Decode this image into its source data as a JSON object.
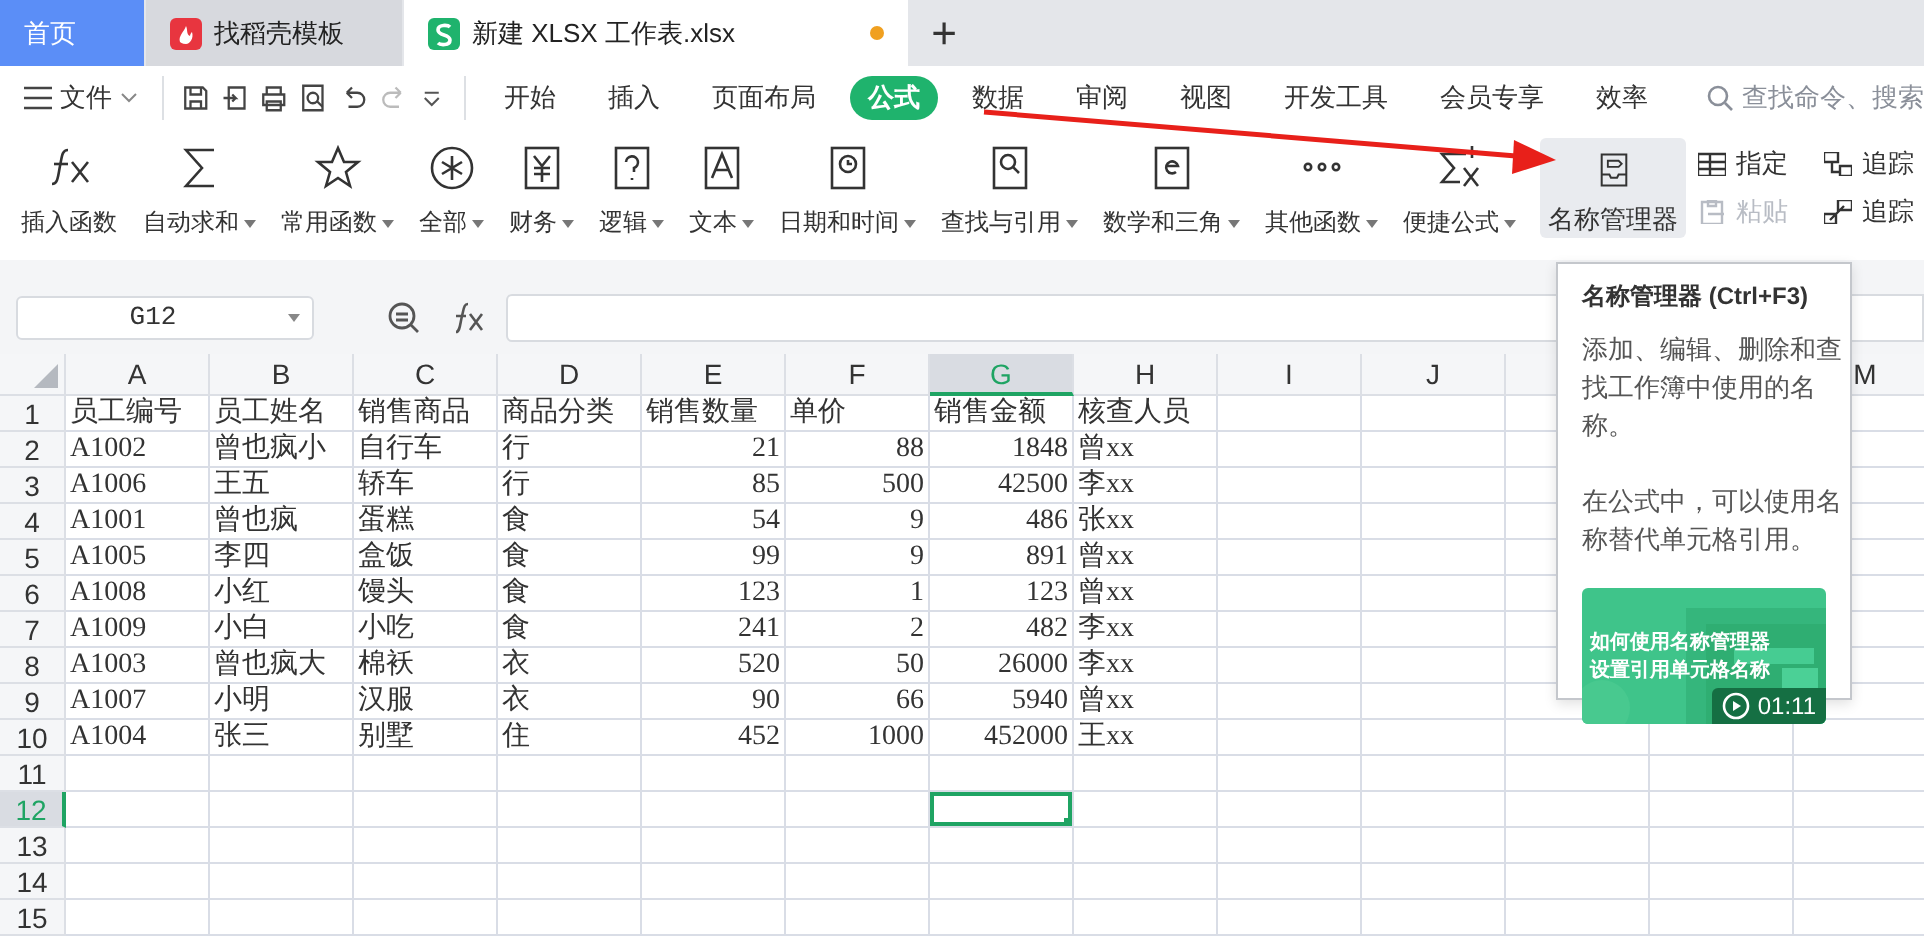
{
  "tabs": [
    {
      "label": "首页",
      "kind": "home",
      "selected": false
    },
    {
      "label": "找稻壳模板",
      "kind": "template",
      "selected": false
    },
    {
      "label": "新建 XLSX 工作表.xlsx",
      "kind": "sheet",
      "selected": true,
      "modified": true
    }
  ],
  "new_tab": "+",
  "file_menu": "文件",
  "menu_tabs": [
    {
      "label": "开始",
      "selected": false
    },
    {
      "label": "插入",
      "selected": false
    },
    {
      "label": "页面布局",
      "selected": false
    },
    {
      "label": "公式",
      "selected": true
    },
    {
      "label": "数据",
      "selected": false
    },
    {
      "label": "审阅",
      "selected": false
    },
    {
      "label": "视图",
      "selected": false
    },
    {
      "label": "开发工具",
      "selected": false
    },
    {
      "label": "会员专享",
      "selected": false
    },
    {
      "label": "效率",
      "selected": false
    }
  ],
  "search": {
    "placeholder": "查找命令、搜索"
  },
  "ribbon": {
    "buttons": [
      {
        "label": "插入函数",
        "kind": "fx",
        "dropdown": false
      },
      {
        "label": "自动求和",
        "kind": "sigma",
        "dropdown": true
      },
      {
        "label": "常用函数",
        "kind": "star",
        "dropdown": true
      },
      {
        "label": "全部",
        "kind": "asterisk",
        "dropdown": true
      },
      {
        "label": "财务",
        "kind": "yen",
        "dropdown": true
      },
      {
        "label": "逻辑",
        "kind": "question",
        "dropdown": true
      },
      {
        "label": "文本",
        "kind": "letter",
        "dropdown": true
      },
      {
        "label": "日期和时间",
        "kind": "clock",
        "dropdown": true
      },
      {
        "label": "查找与引用",
        "kind": "lookup",
        "dropdown": true
      },
      {
        "label": "数学和三角",
        "kind": "math",
        "dropdown": true
      },
      {
        "label": "其他函数",
        "kind": "dots",
        "dropdown": true
      },
      {
        "label": "便捷公式",
        "kind": "sumx",
        "dropdown": true
      }
    ],
    "name_manager": {
      "label": "名称管理器",
      "highlighted": true
    },
    "small_buttons": [
      {
        "label": "指定",
        "kind": "table",
        "disabled": false
      },
      {
        "label": "粘贴",
        "kind": "paste",
        "disabled": true
      }
    ],
    "trace_buttons": [
      {
        "label": "追踪",
        "kind": "precedents"
      },
      {
        "label": "追踪",
        "kind": "dependents"
      }
    ]
  },
  "formula_bar": {
    "name_box": "G12"
  },
  "sheet": {
    "columns": [
      {
        "label": "A",
        "selected": false
      },
      {
        "label": "B",
        "selected": false
      },
      {
        "label": "C",
        "selected": false
      },
      {
        "label": "D",
        "selected": false
      },
      {
        "label": "E",
        "numeric": true,
        "selected": false
      },
      {
        "label": "F",
        "numeric": true,
        "selected": false
      },
      {
        "label": "G",
        "numeric": true,
        "selected": true
      },
      {
        "label": "H",
        "selected": false
      },
      {
        "label": "I",
        "selected": false
      },
      {
        "label": "J",
        "selected": false
      },
      {},
      {},
      {
        "label": "M",
        "selected": false
      }
    ],
    "row_numbers": [
      {
        "label": "1",
        "selected": false
      },
      {
        "label": "2",
        "selected": false
      },
      {
        "label": "3",
        "selected": false
      },
      {
        "label": "4",
        "selected": false
      },
      {
        "label": "5",
        "selected": false
      },
      {
        "label": "6",
        "selected": false
      },
      {
        "label": "7",
        "selected": false
      },
      {
        "label": "8",
        "selected": false
      },
      {
        "label": "9",
        "selected": false
      },
      {
        "label": "10",
        "selected": false
      },
      {
        "label": "11",
        "selected": false
      },
      {
        "label": "12",
        "selected": true
      },
      {
        "label": "13",
        "selected": false
      },
      {
        "label": "14",
        "selected": false
      },
      {
        "label": "15",
        "selected": false
      }
    ],
    "header_row": [
      "员工编号",
      "员工姓名",
      "销售商品",
      "商品分类",
      "销售数量",
      "单价",
      "销售金额",
      "核查人员"
    ],
    "rows": [
      [
        "A1002",
        "曾也疯小",
        "自行车",
        "行",
        "21",
        "88",
        "1848",
        "曾xx"
      ],
      [
        "A1006",
        "王五",
        "轿车",
        "行",
        "85",
        "500",
        "42500",
        "李xx"
      ],
      [
        "A1001",
        "曾也疯",
        "蛋糕",
        "食",
        "54",
        "9",
        "486",
        "张xx"
      ],
      [
        "A1005",
        "李四",
        "盒饭",
        "食",
        "99",
        "9",
        "891",
        "曾xx"
      ],
      [
        "A1008",
        "小红",
        "馒头",
        "食",
        "123",
        "1",
        "123",
        "曾xx"
      ],
      [
        "A1009",
        "小白",
        "小吃",
        "食",
        "241",
        "2",
        "482",
        "李xx"
      ],
      [
        "A1003",
        "曾也疯大",
        "棉袄",
        "衣",
        "520",
        "50",
        "26000",
        "李xx"
      ],
      [
        "A1007",
        "小明",
        "汉服",
        "衣",
        "90",
        "66",
        "5940",
        "曾xx"
      ],
      [
        "A1004",
        "张三",
        "别墅",
        "住",
        "452",
        "1000",
        "452000",
        "王xx"
      ]
    ]
  },
  "tooltip": {
    "title": "名称管理器 (Ctrl+F3)",
    "paragraphs": [
      "添加、编辑、删除和查找工作簿中使用的名称。",
      "在公式中，可以使用名称替代单元格引用。"
    ],
    "video": {
      "title_lines": [
        "如何使用名称管理器",
        "设置引用单元格名称"
      ],
      "duration": "01:11"
    }
  }
}
